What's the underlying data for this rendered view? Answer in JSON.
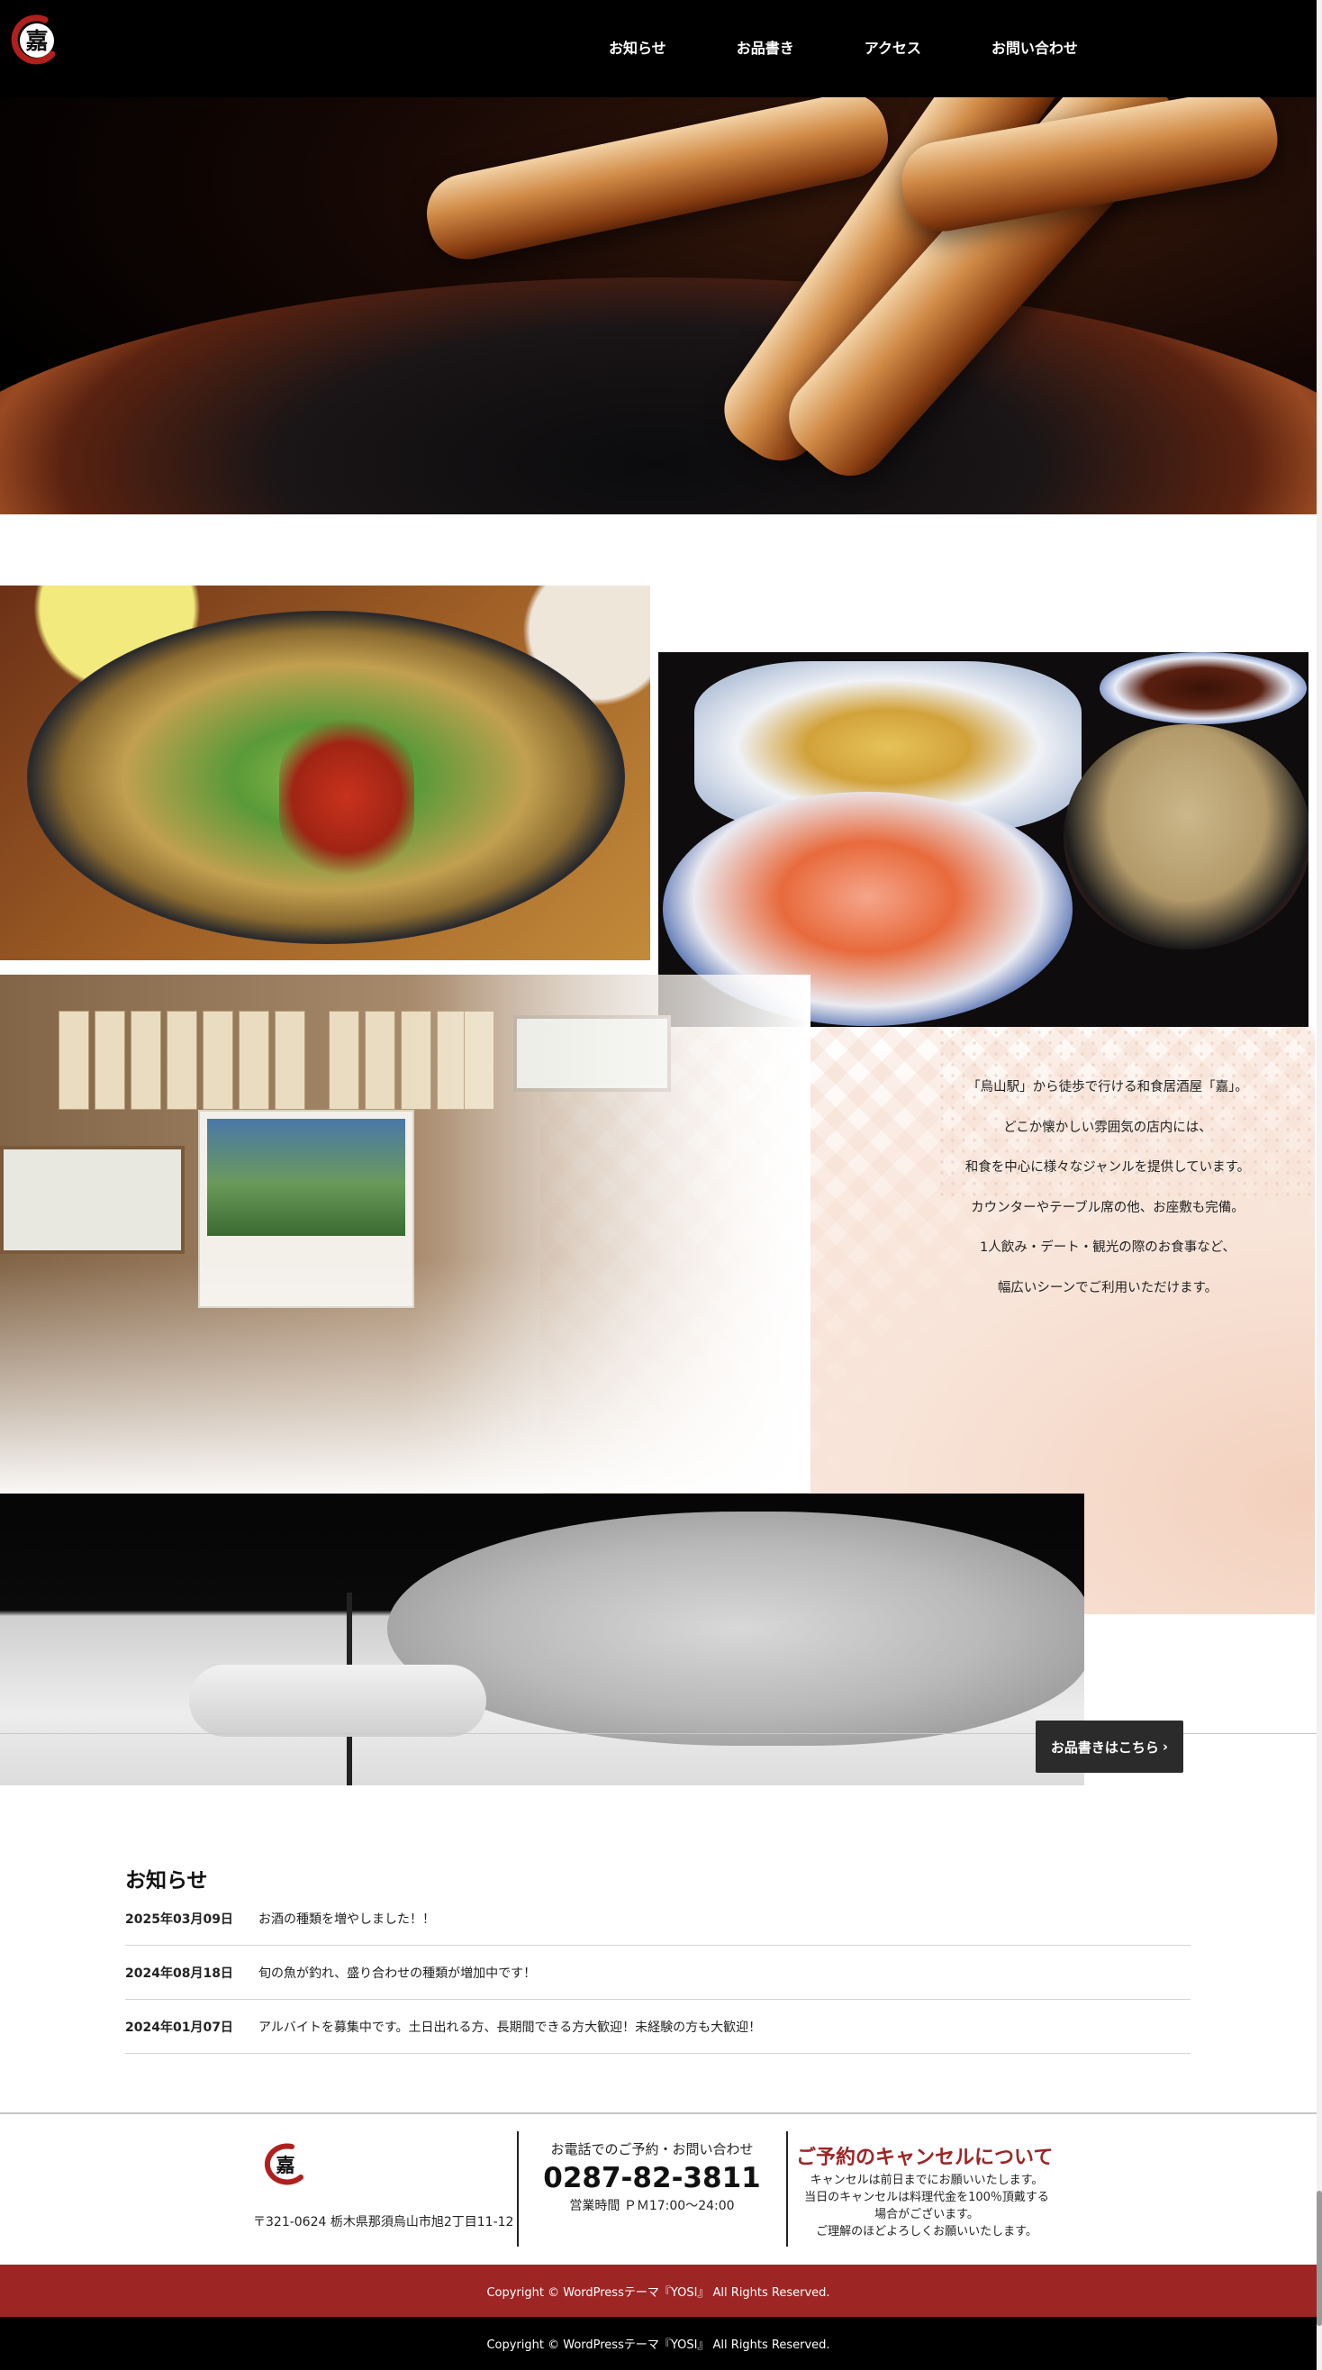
{
  "header": {
    "logo_char": "嘉",
    "nav": [
      "お知らせ",
      "お品書き",
      "アクセス",
      "お問い合わせ"
    ]
  },
  "intro": {
    "lines": [
      "「烏山駅」から徒歩で行ける和食居酒屋「嘉」。",
      "どこか懐かしい雰囲気の店内には、",
      "和食を中心に様々なジャンルを提供しています。",
      "カウンターやテーブル席の他、お座敷も完備。",
      "1人飲み・デート・観光の際のお食事など、",
      "幅広いシーンでご利用いただけます。"
    ]
  },
  "menu_button": "お品書きはこちら",
  "news": {
    "title": "お知らせ",
    "items": [
      {
        "date": "2025年03月09日",
        "text": "お酒の種類を増やしました！！"
      },
      {
        "date": "2024年08月18日",
        "text": "旬の魚が釣れ、盛り合わせの種類が増加中です！"
      },
      {
        "date": "2024年01月07日",
        "text": "アルバイトを募集中です。土日出れる方、長期間できる方大歓迎！未経験の方も大歓迎！"
      }
    ]
  },
  "footer": {
    "logo_char": "嘉",
    "address": "〒321-0624 栃木県那須烏山市旭2丁目11-12",
    "contact_label": "お電話でのご予約・お問い合わせ",
    "tel": "0287-82-3811",
    "hours": "営業時間 ＰＭ17:00〜24:00",
    "cancel_title": "ご予約のキャンセルについて",
    "cancel_lines": [
      "キャンセルは前日までにお願いいたします。",
      "当日のキャンセルは料理代金を100％頂戴する",
      "場合がございます。",
      "ご理解のほどよろしくお願いいたします。"
    ]
  },
  "copyright": "Copyright © WordPressテーマ『YOSI』 All Rights Reserved.",
  "colors": {
    "brand_red": "#9d2625",
    "header_bg": "#000000"
  }
}
